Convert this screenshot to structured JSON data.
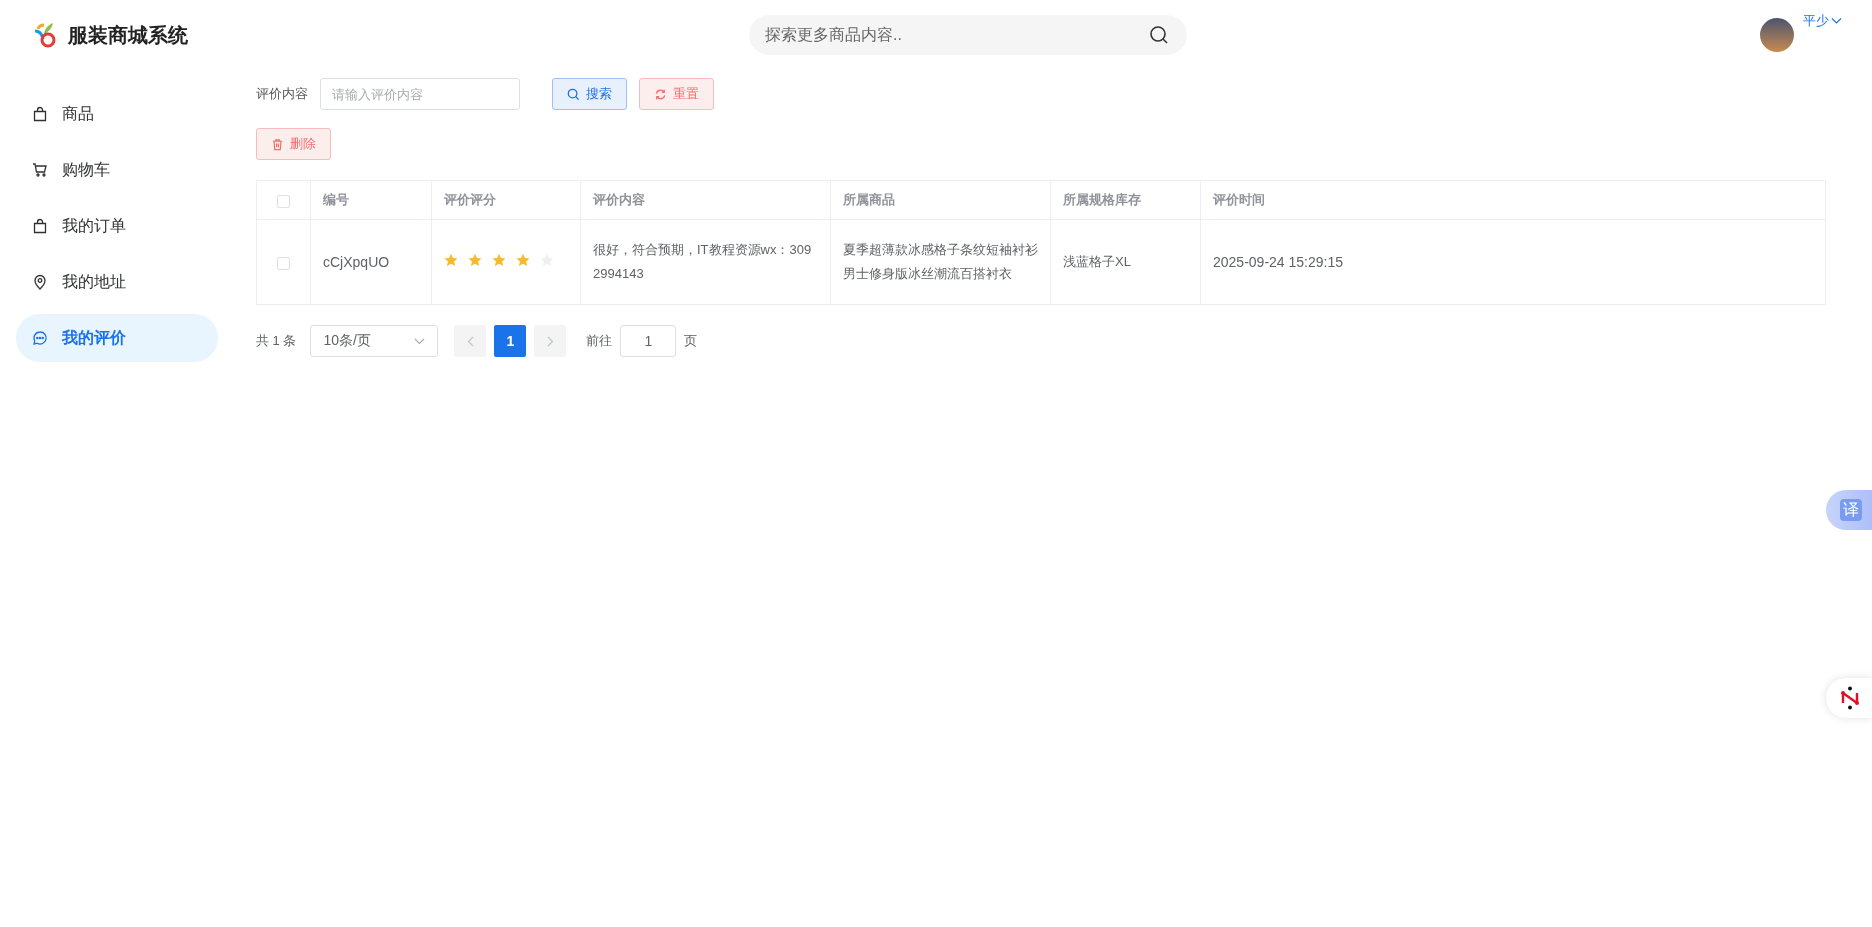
{
  "header": {
    "title": "服装商城系统",
    "search": {
      "placeholder": "探索更多商品内容.."
    },
    "user": {
      "name": "平少"
    }
  },
  "sidebar": {
    "items": [
      {
        "label": "商品",
        "kind": "bag",
        "selected": false
      },
      {
        "label": "购物车",
        "kind": "cart",
        "selected": false
      },
      {
        "label": "我的订单",
        "kind": "bag",
        "selected": false
      },
      {
        "label": "我的地址",
        "kind": "pin",
        "selected": false
      },
      {
        "label": "我的评价",
        "kind": "chat",
        "selected": true
      }
    ]
  },
  "filter": {
    "label": "评价内容",
    "input": {
      "placeholder": "请输入评价内容"
    },
    "buttons": [
      {
        "label": "搜索",
        "kind": "search"
      },
      {
        "label": "重置",
        "kind": "reset"
      }
    ]
  },
  "toolbar": {
    "buttons": [
      {
        "label": "删除",
        "kind": "delete"
      }
    ]
  },
  "table": {
    "select_all": {
      "checked": false
    },
    "columns": [
      "编号",
      "评价评分",
      "评价内容",
      "所属商品",
      "所属规格库存",
      "评价时间"
    ],
    "rows": [
      {
        "checked": false,
        "id": "cCjXpqUO",
        "stars": 4,
        "content": "很好，符合预期，IT教程资源wx：3092994143",
        "product": "夏季超薄款冰感格子条纹短袖衬衫男士修身版冰丝潮流百搭衬衣",
        "spec": "浅蓝格子XL",
        "time": "2025-09-24 15:29:15"
      }
    ]
  },
  "pagination": {
    "total": "共 1 条",
    "page_size": "10条/页",
    "pages": [
      {
        "label": "1",
        "selected": true
      }
    ],
    "goto_label": "前往",
    "goto_value": "1",
    "goto_suffix": "页"
  },
  "floating": {
    "translate": "译"
  }
}
